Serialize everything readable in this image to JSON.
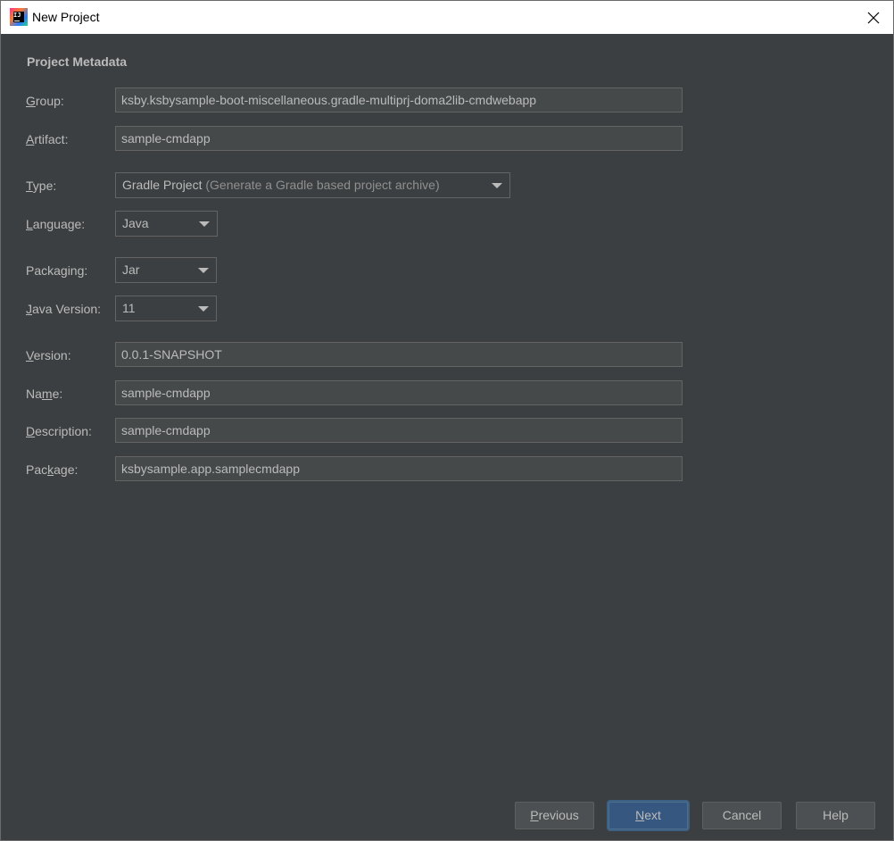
{
  "window": {
    "title": "New Project",
    "icon": "intellij-idea-icon",
    "icon_text": "IJ"
  },
  "section": {
    "title": "Project Metadata"
  },
  "fields": {
    "group": {
      "label_mn": "G",
      "label_rest": "roup:",
      "value": "ksby.ksbysample-boot-miscellaneous.gradle-multiprj-doma2lib-cmdwebapp"
    },
    "artifact": {
      "label_mn": "A",
      "label_rest": "rtifact:",
      "value": "sample-cmdapp"
    },
    "type": {
      "label_mn": "T",
      "label_rest": "ype:",
      "value": "Gradle Project",
      "hint": "(Generate a Gradle based project archive)"
    },
    "language": {
      "label_pre": "",
      "label_mn": "L",
      "label_rest": "anguage:",
      "value": "Java"
    },
    "packaging": {
      "label_pre": "Packaging:",
      "value": "Jar"
    },
    "java_version": {
      "label_mn": "J",
      "label_rest": "ava Version:",
      "value": "11"
    },
    "version": {
      "label_mn": "V",
      "label_rest": "ersion:",
      "value": "0.0.1-SNAPSHOT"
    },
    "name": {
      "label_pre": "Na",
      "label_mn": "m",
      "label_rest": "e:",
      "value": "sample-cmdapp"
    },
    "description": {
      "label_mn": "D",
      "label_rest": "escription:",
      "value": "sample-cmdapp"
    },
    "package": {
      "label_pre": "Pac",
      "label_mn": "k",
      "label_rest": "age:",
      "value": "ksbysample.app.samplecmdapp"
    }
  },
  "buttons": {
    "previous": {
      "mn": "P",
      "rest": "revious"
    },
    "next": {
      "mn": "N",
      "rest": "ext"
    },
    "cancel": {
      "label": "Cancel"
    },
    "help": {
      "label": "Help"
    }
  },
  "colors": {
    "background": "#3c3f41",
    "text": "#bbbbbb",
    "field_bg": "#45494a",
    "primary_button": "#365880"
  }
}
